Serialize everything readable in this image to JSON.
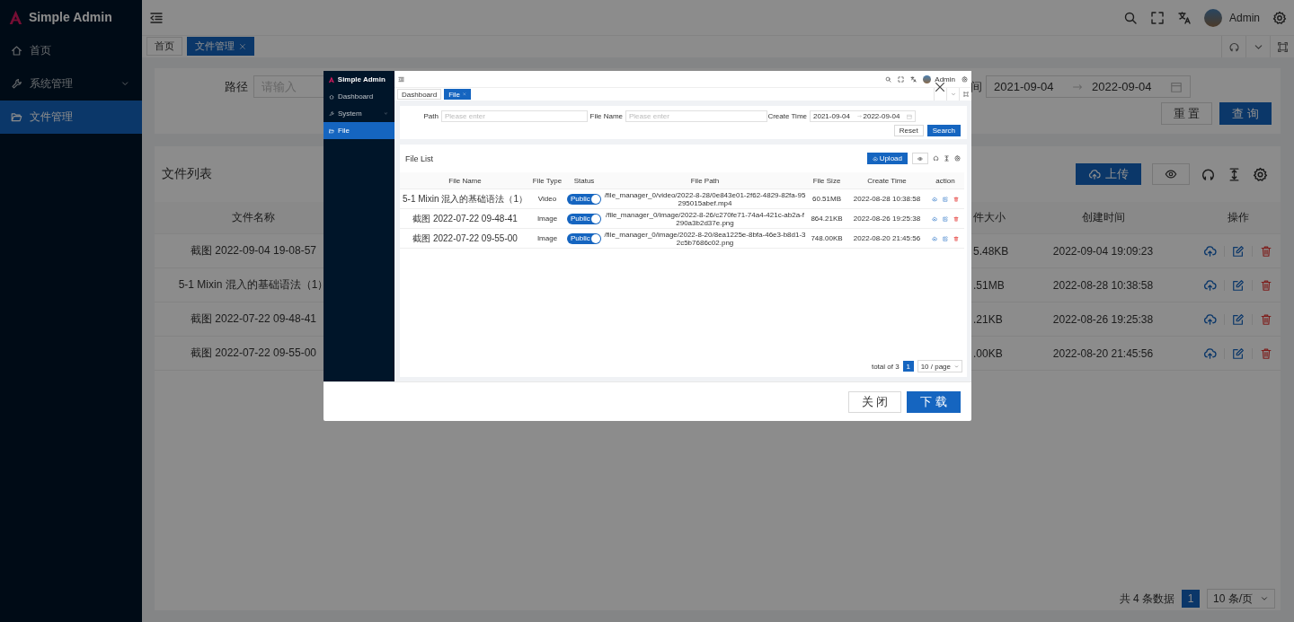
{
  "sidebar": {
    "logo": "Simple Admin",
    "menu": [
      {
        "label": "首页",
        "kind": "home",
        "selected": false,
        "expandable": false
      },
      {
        "label": "系统管理",
        "kind": "tool",
        "selected": false,
        "expandable": true
      },
      {
        "label": "文件管理",
        "kind": "folder",
        "selected": true,
        "expandable": false
      }
    ]
  },
  "header": {
    "user": "Admin"
  },
  "tabs": [
    {
      "label": "首页",
      "selected": false,
      "closable": false
    },
    {
      "label": "文件管理",
      "selected": true,
      "closable": true
    }
  ],
  "search_form": {
    "path_label": "路径",
    "path_placeholder": "请输入",
    "time_label": "间",
    "date_start": "2021-09-04",
    "date_end": "2022-09-04",
    "buttons": [
      {
        "label": "重 置",
        "kind": "default"
      },
      {
        "label": "查 询",
        "kind": "primary"
      }
    ]
  },
  "file_list": {
    "title": "文件列表",
    "upload": "上传",
    "columns": {
      "name": "文件名称",
      "size": "件大小",
      "created": "创建时间",
      "actions": "操作"
    },
    "rows": [
      {
        "name": "截图 2022-09-04 19-08-57",
        "size": "5.48KB",
        "created": "2022-09-04 19:09:23"
      },
      {
        "name": "5-1 Mixin 混入的基础语法（1）",
        "size": ".51MB",
        "created": "2022-08-28 10:38:58"
      },
      {
        "name": "截图 2022-07-22 09-48-41",
        "size": ".21KB",
        "created": "2022-08-26 19:25:38"
      },
      {
        "name": "截图 2022-07-22 09-55-00",
        "size": ".00KB",
        "created": "2022-08-20 21:45:56"
      }
    ],
    "pagination": {
      "total": "共 4 条数据",
      "pages": [
        {
          "label": "1",
          "selected": true
        }
      ],
      "page_size": "10 条/页"
    }
  },
  "dialog": {
    "preview": {
      "sidebar": {
        "logo": "Simple Admin",
        "menu": [
          {
            "label": "Dashboard",
            "kind": "home",
            "selected": false,
            "expandable": false
          },
          {
            "label": "System",
            "kind": "tool",
            "selected": false,
            "expandable": true
          },
          {
            "label": "File",
            "kind": "folder",
            "selected": true,
            "expandable": false
          }
        ]
      },
      "header": {
        "user": "Admin"
      },
      "tabs": [
        {
          "label": "Dashboard",
          "selected": false,
          "closable": false
        },
        {
          "label": "File",
          "selected": true,
          "closable": true
        }
      ],
      "search_form": {
        "fields": [
          {
            "label": "Path",
            "placeholder": "Please enter"
          },
          {
            "label": "File Name",
            "placeholder": "Please enter"
          }
        ],
        "time_label": "Create Time",
        "date_start": "2021-09-04",
        "date_end": "2022-09-04",
        "buttons": [
          {
            "label": "Reset",
            "kind": "default"
          },
          {
            "label": "Search",
            "kind": "primary"
          }
        ]
      },
      "file_list": {
        "title": "File List",
        "upload": "Upload",
        "columns": [
          "File Name",
          "File Type",
          "Status",
          "File Path",
          "File Size",
          "Create Time",
          "action"
        ],
        "rows": [
          {
            "name": "5-1 Mixin 混入的基础语法（1）",
            "type": "Video",
            "status": {
              "label": "Public",
              "on": true
            },
            "path": "/file_manager_0/video/2022-8-28/0e843e01-2f62-4829-82fa-95295015abef.mp4",
            "size": "60.51MB",
            "created": "2022-08-28 10:38:58"
          },
          {
            "name": "截图 2022-07-22 09-48-41",
            "type": "Image",
            "status": {
              "label": "Public",
              "on": true
            },
            "path": "/file_manager_0/image/2022-8-26/c270fe71-74a4-421c-ab2a-f290a3b2d37e.png",
            "size": "864.21KB",
            "created": "2022-08-26 19:25:38"
          },
          {
            "name": "截图 2022-07-22 09-55-00",
            "type": "Image",
            "status": {
              "label": "Public",
              "on": true
            },
            "path": "/file_manager_0/image/2022-8-20/8ea1225e-8bfa-46e3-b8d1-32c5b7686c02.png",
            "size": "748.00KB",
            "created": "2022-08-20 21:45:56"
          }
        ],
        "pagination": {
          "total": "total of 3",
          "pages": [
            {
              "label": "1",
              "selected": true
            }
          ],
          "page_size": "10 / page"
        }
      }
    },
    "buttons": [
      {
        "label": "关 闭",
        "kind": "default"
      },
      {
        "label": "下 载",
        "kind": "primary"
      }
    ]
  }
}
